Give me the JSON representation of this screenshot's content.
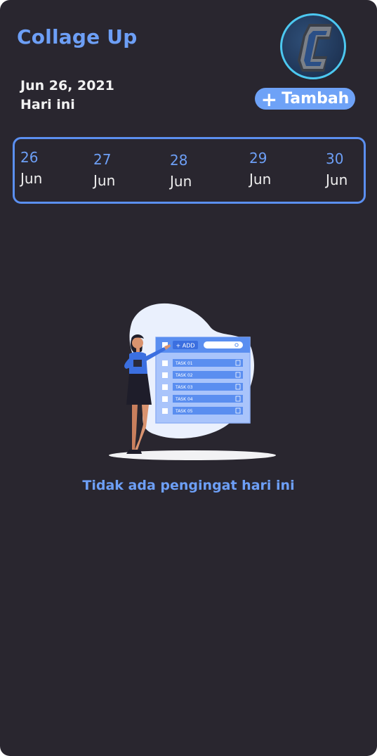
{
  "header": {
    "title": "Collage Up",
    "date": "Jun 26, 2021",
    "today_label": "Hari ini",
    "add_button": {
      "icon": "plus-icon",
      "label": "Tambah"
    }
  },
  "avatar": {
    "icon": "logo-c-icon"
  },
  "date_strip": {
    "days": [
      {
        "day": "26",
        "month": "Jun"
      },
      {
        "day": "27",
        "month": "Jun"
      },
      {
        "day": "28",
        "month": "Jun"
      },
      {
        "day": "29",
        "month": "Jun"
      },
      {
        "day": "30",
        "month": "Jun"
      }
    ]
  },
  "illustration": {
    "add_label": "+ ADD",
    "tasks": [
      "TASK 01",
      "TASK 02",
      "TASK 03",
      "TASK 04",
      "TASK 05"
    ]
  },
  "empty_state": {
    "message": "Tidak ada pengingat hari ini"
  },
  "colors": {
    "background": "#29262f",
    "accent": "#6d9ff6",
    "button": "#6ea2f7",
    "avatar_ring": "#4cc8f0"
  }
}
